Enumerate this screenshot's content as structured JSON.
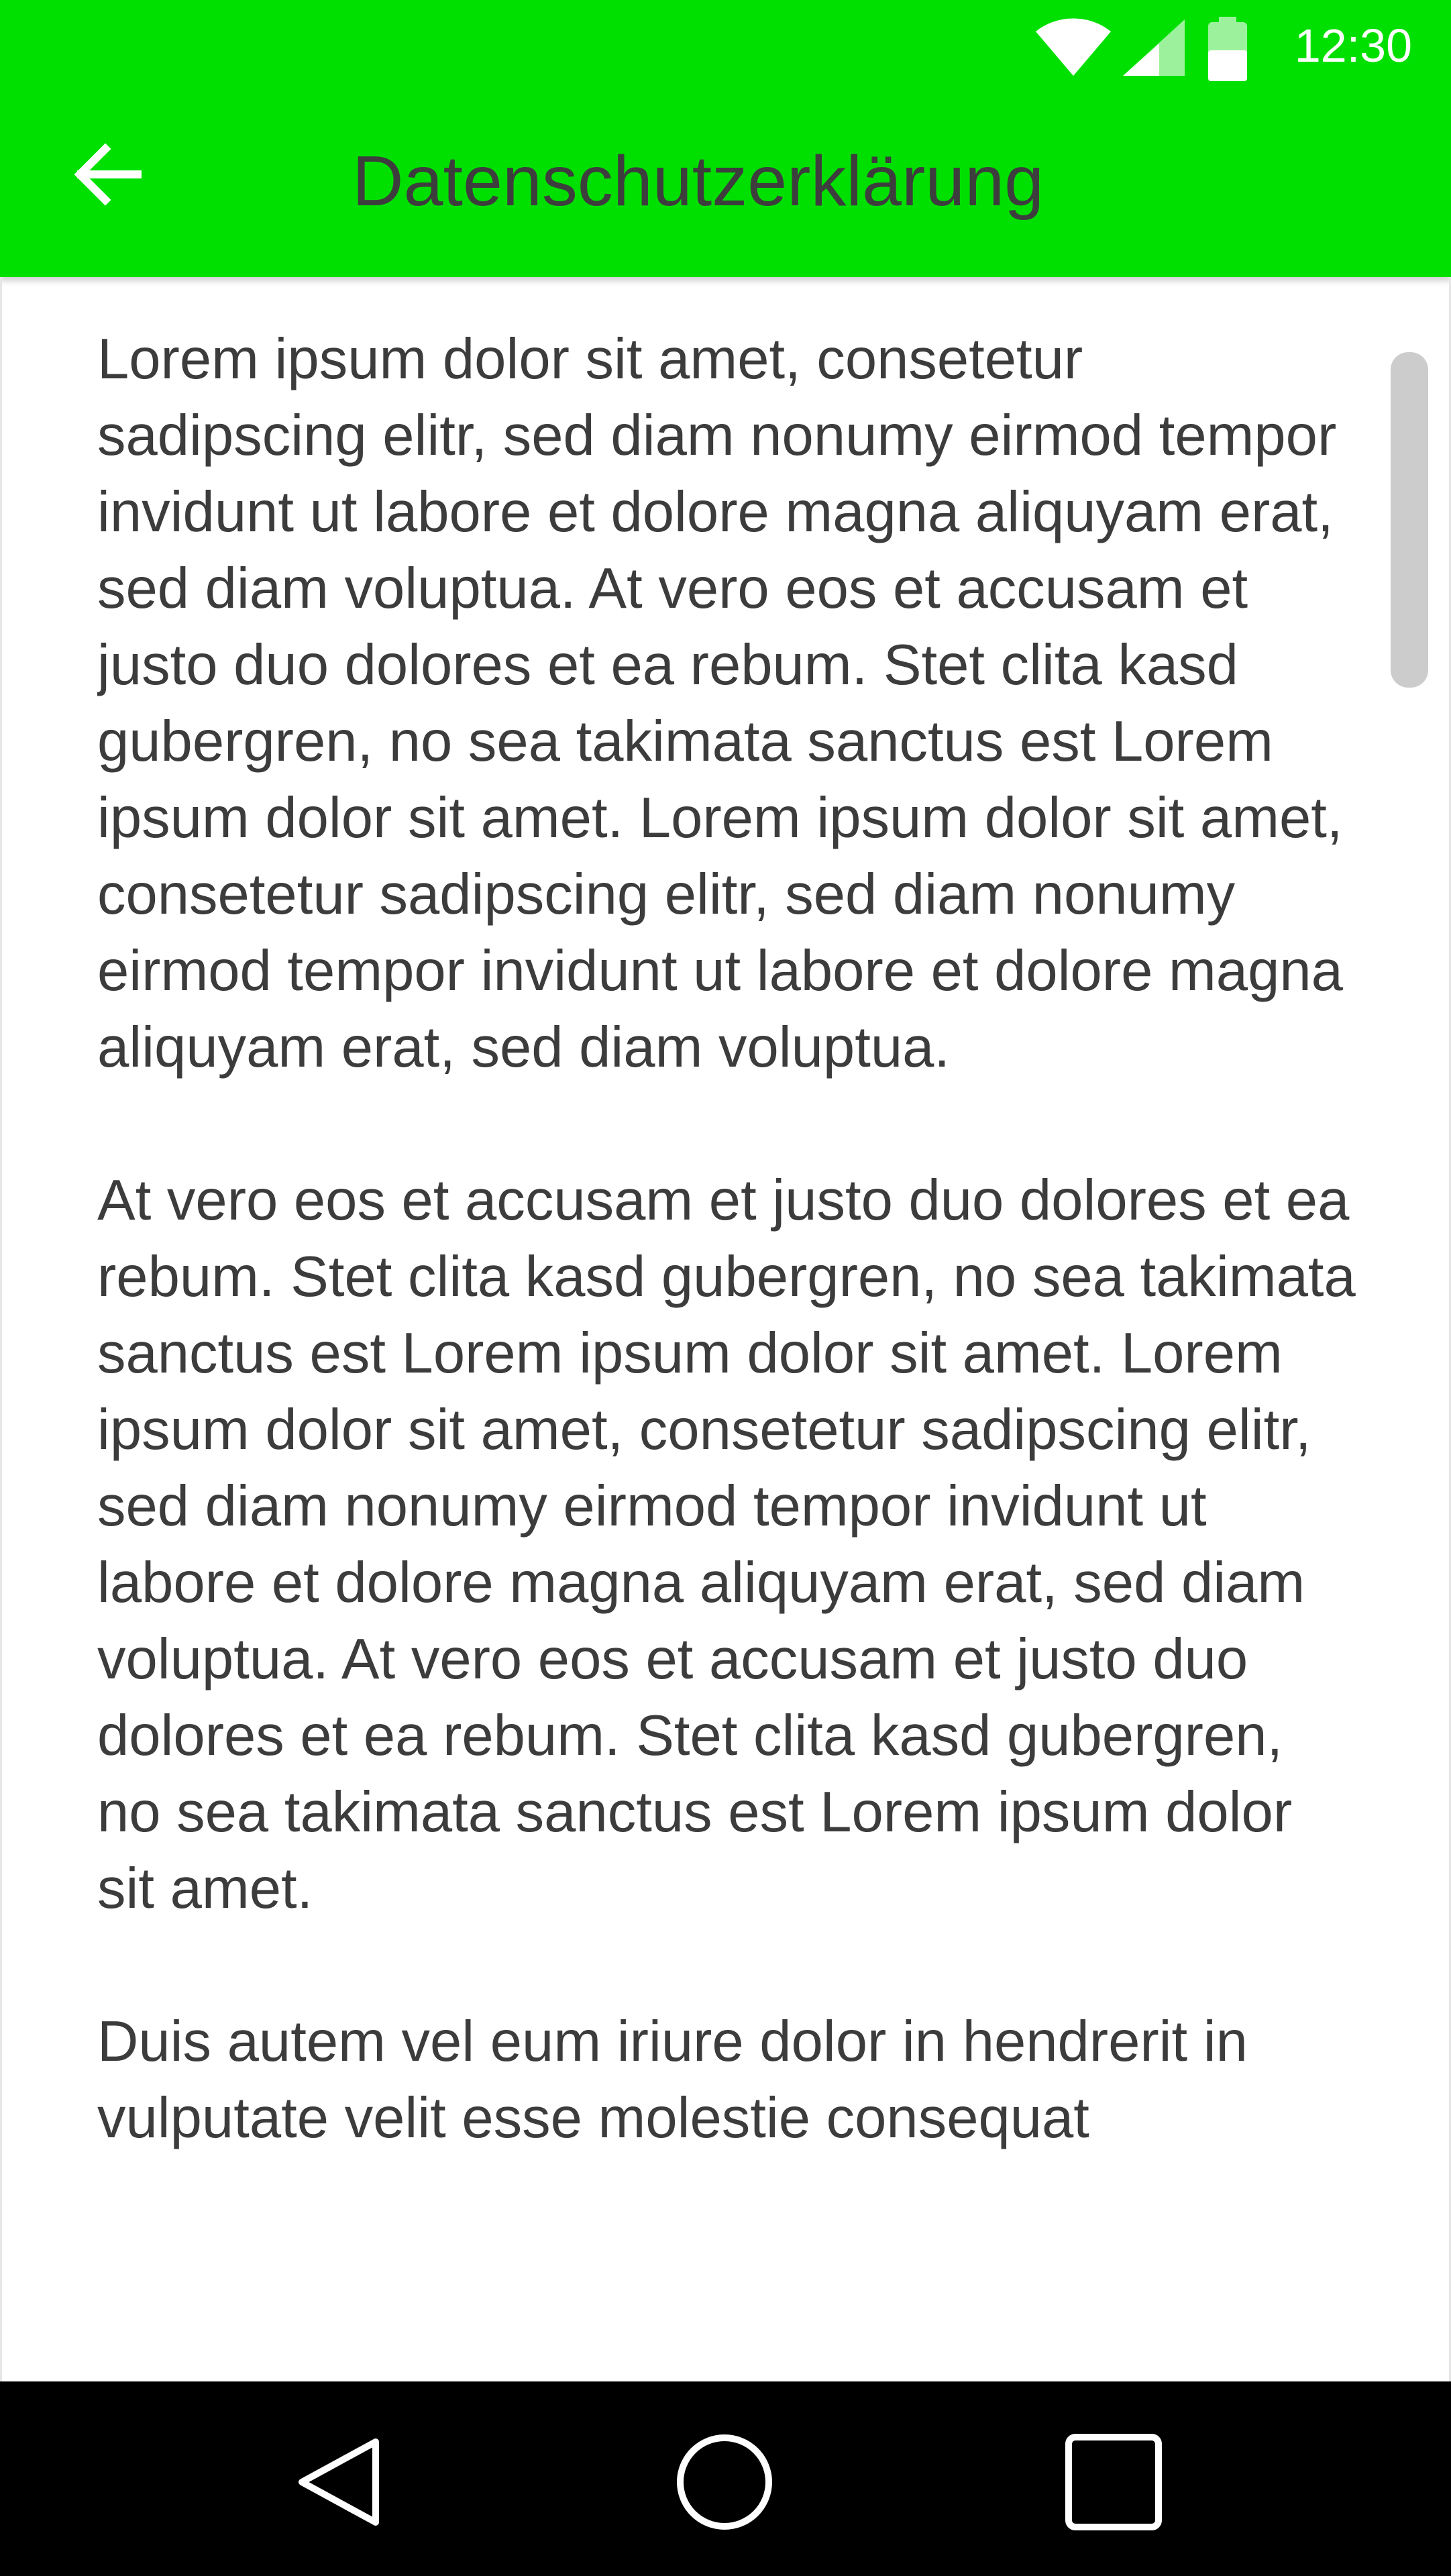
{
  "status_bar": {
    "time": "12:30",
    "icons": [
      "wifi-icon",
      "cell-signal-icon",
      "battery-icon"
    ],
    "background": "#00e000"
  },
  "app_bar": {
    "title": "Datenschutzerklärung",
    "back_icon": "arrow-back-icon",
    "background": "#00e000",
    "title_color": "#3d3d3d"
  },
  "content": {
    "paragraphs": [
      "Lorem ipsum dolor sit amet, consetetur sadipscing elitr, sed diam nonumy eirmod tempor invidunt ut labore et dolore magna aliquyam erat, sed diam voluptua. At vero eos et accusam et justo duo dolores et ea rebum. Stet clita kasd gubergren, no sea takimata sanctus est Lorem ipsum dolor sit amet. Lorem ipsum dolor sit amet, consetetur sadipscing elitr, sed diam nonumy eirmod tempor invidunt ut labore et dolore magna aliquyam erat, sed diam voluptua.",
      "At vero eos et accusam et justo duo dolores et ea rebum. Stet clita kasd gubergren, no sea takimata sanctus est Lorem ipsum dolor sit amet. Lorem ipsum dolor sit amet, consetetur sadipscing elitr, sed diam nonumy eirmod tempor invidunt ut labore et dolore magna aliquyam erat, sed diam voluptua. At vero eos et accusam et justo duo dolores et ea rebum. Stet clita kasd gubergren, no sea takimata sanctus est Lorem ipsum dolor sit amet.",
      "Duis autem vel eum iriure dolor in hendrerit in vulputate velit esse molestie consequat"
    ]
  },
  "nav_bar": {
    "icons": [
      "nav-back-icon",
      "nav-home-icon",
      "nav-recents-icon"
    ]
  }
}
